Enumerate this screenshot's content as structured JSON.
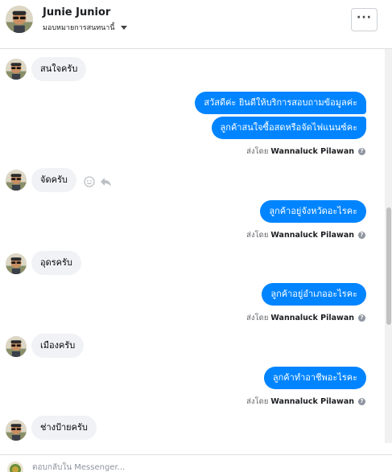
{
  "header": {
    "contact_name": "Junie Junior",
    "assign_label": "มอบหมายการสนทนานี้",
    "more_label": "···"
  },
  "messages": {
    "m1_text": "สนใจครับ",
    "m2_text": "สวัสดีค่ะ  ยินดีให้บริการสอบถามข้อมูลค่ะ",
    "m3_text": "ลูกค้าสนใจซื้อสดหรือจัดไฟแนนซ์คะ",
    "m4_text": "จัดครับ",
    "m5_text": "ลูกค้าอยู่จังหวัดอะไรคะ",
    "m6_text": "อุดรครับ",
    "m7_text": "ลูกค้าอยู่อำเภออะไรคะ",
    "m8_text": "เมืองครับ",
    "m9_text": "ลูกค้าทำอาชีพอะไรคะ",
    "m10_text": "ช่างป้ายครับ"
  },
  "sent_by": {
    "prefix": "ส่งโดย",
    "sender_name": "Wannaluck Pilawan",
    "help_glyph": "?"
  },
  "composer": {
    "placeholder": "ตอบกลับใน Messenger..."
  },
  "colors": {
    "outgoing_bubble": "#0084ff",
    "incoming_bubble": "#f0f2f5",
    "border": "#dddfe2"
  },
  "icons": {
    "more": "ellipsis-icon",
    "assign_dropdown": "caret-down-icon",
    "react": "smiley-icon",
    "reply": "reply-arrow-icon",
    "help": "question-circle-icon"
  }
}
